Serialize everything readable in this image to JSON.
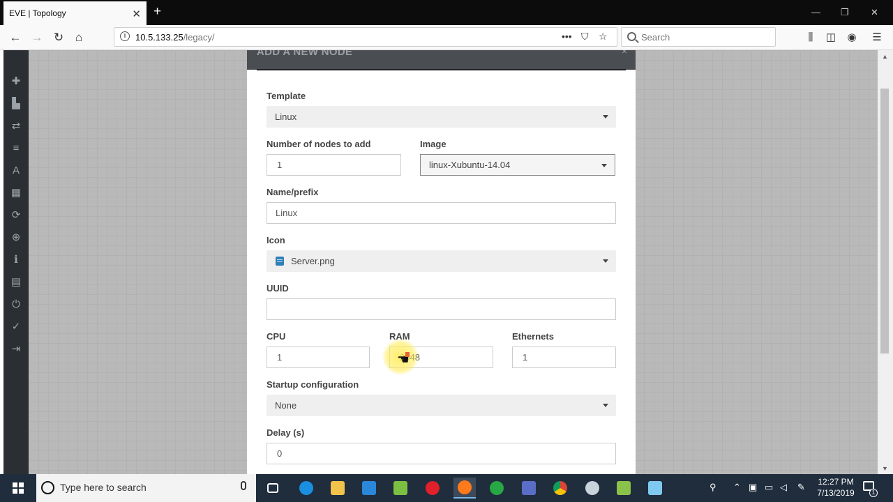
{
  "browser": {
    "tab_title": "EVE | Topology",
    "tab_close": "✕",
    "new_tab": "+",
    "url_host": "10.5.133.25",
    "url_path": "/legacy/",
    "search_placeholder": "Search",
    "window_controls": [
      "—",
      "❐",
      "✕"
    ]
  },
  "modal": {
    "title": "ADD A NEW NODE",
    "close": "×",
    "template": {
      "label": "Template",
      "value": "Linux"
    },
    "nodes_count": {
      "label": "Number of nodes to add",
      "value": "1"
    },
    "image": {
      "label": "Image",
      "value": "linux-Xubuntu-14.04"
    },
    "name_prefix": {
      "label": "Name/prefix",
      "value": "Linux"
    },
    "icon": {
      "label": "Icon",
      "value": "Server.png"
    },
    "uuid": {
      "label": "UUID",
      "value": ""
    },
    "cpu": {
      "label": "CPU",
      "value": "1"
    },
    "ram": {
      "label": "RAM",
      "value": "2048"
    },
    "ethernets": {
      "label": "Ethernets",
      "value": "1"
    },
    "startup_config": {
      "label": "Startup configuration",
      "value": "None"
    },
    "delay": {
      "label": "Delay (s)",
      "value": "0"
    }
  },
  "taskbar": {
    "search_placeholder": "Type here to search",
    "time": "12:27 PM",
    "date": "7/13/2019",
    "notification_count": "1"
  },
  "colors": {
    "toolbar_bg": "#2b2f33",
    "modal_header": "#4a4d52",
    "taskbar_bg": "#1f2d3d"
  }
}
